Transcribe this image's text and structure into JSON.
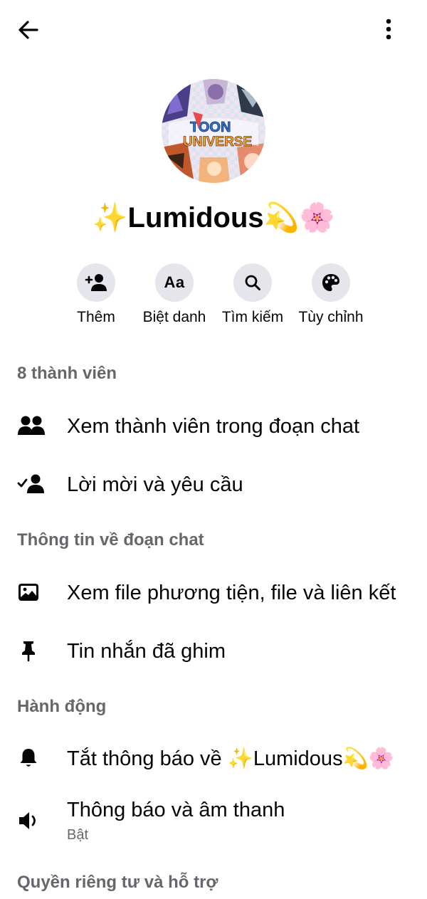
{
  "header": {
    "back_icon": "arrow-left-icon",
    "more_icon": "more-vertical-icon"
  },
  "group": {
    "name": "✨Lumidous💫🌸",
    "avatar_text": "TOON UNIVERSE"
  },
  "actions": [
    {
      "label": "Thêm",
      "icon": "add-person-icon"
    },
    {
      "label": "Biệt danh",
      "icon": "nickname-aa-icon"
    },
    {
      "label": "Tìm kiếm",
      "icon": "search-icon"
    },
    {
      "label": "Tùy chỉnh",
      "icon": "palette-icon"
    }
  ],
  "sections": {
    "members": {
      "title": "8 thành viên",
      "items": [
        {
          "label": "Xem thành viên trong đoạn chat",
          "icon": "people-icon"
        },
        {
          "label": "Lời mời và yêu cầu",
          "icon": "person-check-icon"
        }
      ]
    },
    "chat_info": {
      "title": "Thông tin về đoạn chat",
      "items": [
        {
          "label": "Xem file phương tiện, file và liên kết",
          "icon": "image-icon"
        },
        {
          "label": "Tin nhắn đã ghim",
          "icon": "pin-icon"
        }
      ]
    },
    "actions": {
      "title": "Hành động",
      "items": [
        {
          "label": "Tắt thông báo về ✨Lumidous💫🌸",
          "icon": "bell-icon"
        },
        {
          "label": "Thông báo và âm thanh",
          "sublabel": "Bật",
          "icon": "speaker-icon"
        }
      ]
    },
    "privacy": {
      "title": "Quyền riêng tư và hỗ trợ"
    }
  }
}
